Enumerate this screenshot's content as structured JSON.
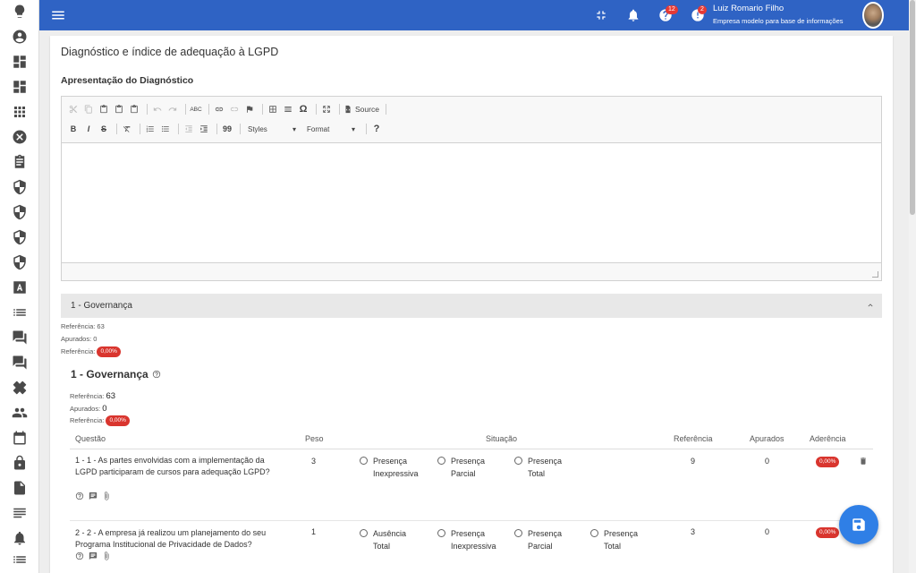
{
  "header": {
    "user_name": "Luiz Romario Filho",
    "company": "Empresa modelo para base de informações",
    "badges": {
      "help": "12",
      "alerts": "2"
    }
  },
  "sidebar": {
    "icons": [
      "lightbulb-icon",
      "account-icon",
      "dashboard-icon",
      "dashboard-alt-icon",
      "apps-icon",
      "cancel-icon",
      "clipboard-icon",
      "shield-icon",
      "shield-icon",
      "shield-icon",
      "shield-icon",
      "font-icon",
      "list-icon",
      "forum-icon",
      "forum-icon",
      "healing-icon",
      "people-icon",
      "calendar-icon",
      "lock-icon",
      "document-icon",
      "text-icon",
      "alarm-icon",
      "list-alt-icon"
    ]
  },
  "page": {
    "title": "Diagnóstico e índice de adequação à LGPD",
    "section_title": "Apresentação do Diagnóstico"
  },
  "editor": {
    "source_label": "Source",
    "styles_label": "Styles",
    "format_label": "Format",
    "bold": "B",
    "italic": "I",
    "strike": "S",
    "quote": "99",
    "help": "?",
    "omega": "Ω",
    "spell": "ABC"
  },
  "governance": {
    "header_label": "1 - Governança",
    "summary": {
      "ref_label": "Referência: 63",
      "apurados_label": "Apurados: 0",
      "ref2_label": "Referência:",
      "pct": "0,00%"
    },
    "title": "1 - Governança",
    "detail": {
      "ref_label": "Referência:",
      "ref_value": "63",
      "apurados_label": "Apurados:",
      "apurados_value": "0",
      "ref2_label": "Referência:",
      "pct": "0,00%"
    },
    "columns": {
      "questao": "Questão",
      "peso": "Peso",
      "situacao": "Situação",
      "referencia": "Referência",
      "apurados": "Apurados",
      "aderencia": "Aderência"
    },
    "rows": [
      {
        "question": "1 - 1 - As partes envolvidas com a implementação da LGPD participaram de cursos para adequação LGPD?",
        "peso": "3",
        "options": [
          "Presença Inexpressiva",
          "Presença Parcial",
          "Presença Total"
        ],
        "referencia": "9",
        "apurados": "0",
        "aderencia": "0,00%"
      },
      {
        "question": "2 - 2 - A empresa já realizou um planejamento do seu Programa Institucional de Privacidade de Dados?",
        "peso": "1",
        "options": [
          "Ausência Total",
          "Presença Inexpressiva",
          "Presença Parcial",
          "Presença Total"
        ],
        "referencia": "3",
        "apurados": "0",
        "aderencia": "0,00%"
      }
    ]
  }
}
